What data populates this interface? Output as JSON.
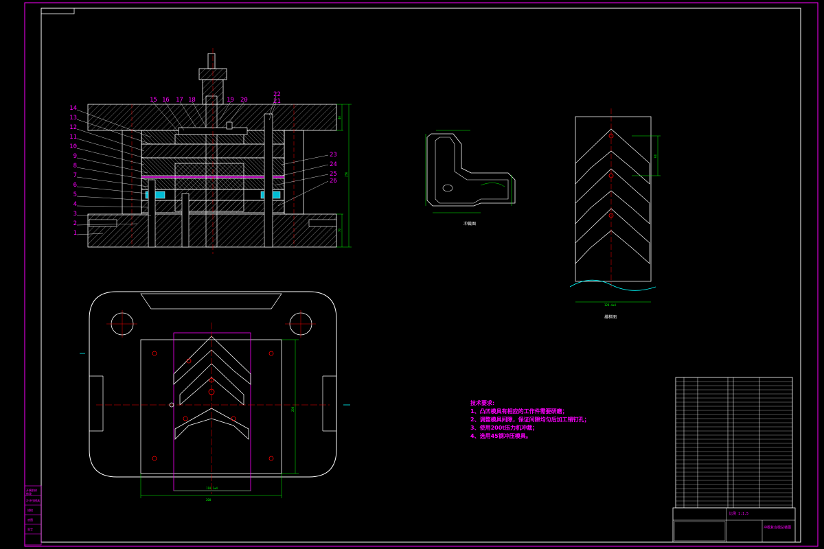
{
  "drawing": {
    "part_numbers_left": [
      "14",
      "13",
      "12",
      "11",
      "10",
      "9",
      "8",
      "7",
      "6",
      "5",
      "4",
      "3",
      "2",
      "1"
    ],
    "part_numbers_top": [
      "15",
      "16",
      "17",
      "18",
      "19",
      "20",
      "22",
      "21"
    ],
    "part_numbers_right": [
      "23",
      "24",
      "25",
      "26"
    ],
    "dims_section": [
      "40",
      "256",
      "70"
    ],
    "dims_plan": [
      "200",
      "118.2±4",
      "200"
    ],
    "label_blank": "冲裁图",
    "label_strip": "排样图",
    "dim_strip_width": "128.4±4",
    "dim_strip_pitch": "64",
    "notes": {
      "heading": "技术要求:",
      "items": [
        "1、凸凹模具有相应的工作件需要研磨；",
        "2、调整模具间隙，保证间隙均匀后加工销钉孔；",
        "3、使用200t压力机冲裁；",
        "4、选用45钢冲压模具。"
      ]
    },
    "title_block": {
      "drawing_title": "冲模复合模总装图",
      "scale_note": "比例  1:1.5"
    },
    "side_labels": [
      "开模前修",
      "修改",
      "冷冲压模具",
      "描校",
      "底图",
      "签字"
    ]
  },
  "colors": {
    "line": "#ffffff",
    "accent": "#ff00ff",
    "dim": "#00ff00",
    "center": "#ff0000",
    "hatch": "#ffffff",
    "cyan": "#00ffff"
  }
}
